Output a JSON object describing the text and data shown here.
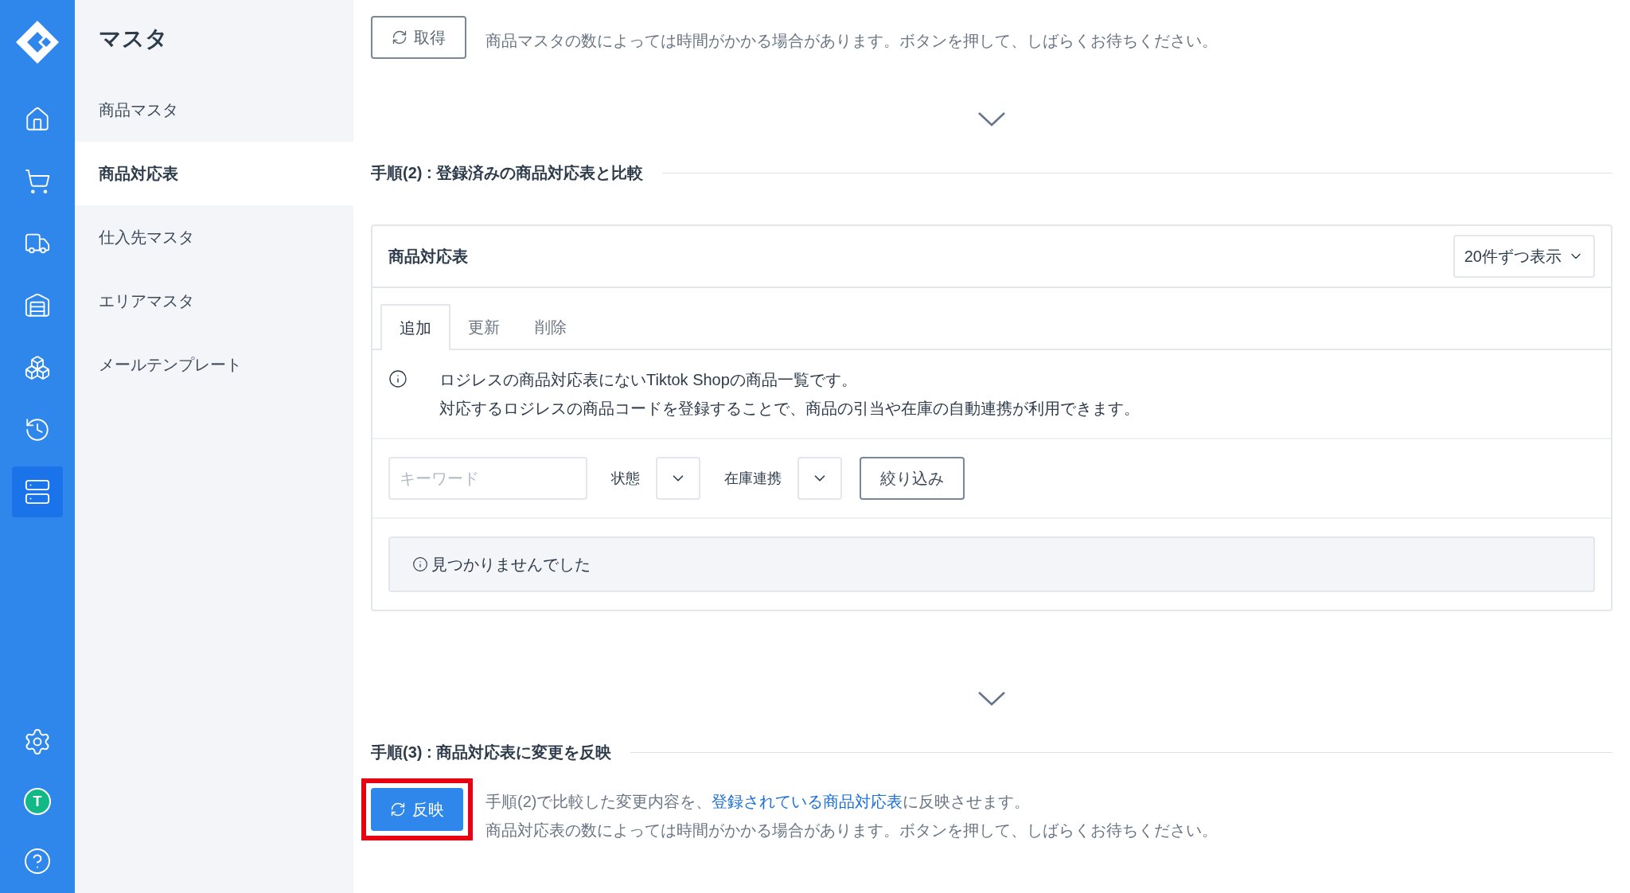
{
  "rail": {
    "items": [
      {
        "kind": "home",
        "selected": false
      },
      {
        "kind": "cart",
        "selected": false
      },
      {
        "kind": "truck",
        "selected": false
      },
      {
        "kind": "warehouse",
        "selected": false
      },
      {
        "kind": "boxes",
        "selected": false
      },
      {
        "kind": "history",
        "selected": false
      },
      {
        "kind": "master",
        "selected": true
      }
    ],
    "bottom": [
      {
        "kind": "settings"
      },
      {
        "kind": "avatar",
        "label": "T"
      },
      {
        "kind": "help"
      }
    ]
  },
  "sidebar": {
    "title": "マスタ",
    "items": [
      {
        "label": "商品マスタ",
        "selected": false
      },
      {
        "label": "商品対応表",
        "selected": true
      },
      {
        "label": "仕入先マスタ",
        "selected": false
      },
      {
        "label": "エリアマスタ",
        "selected": false
      },
      {
        "label": "メールテンプレート",
        "selected": false
      }
    ]
  },
  "step1": {
    "button": "取得",
    "note": "商品マスタの数によっては時間がかかる場合があります。ボタンを押して、しばらくお待ちください。"
  },
  "step2": {
    "heading": "手順(2) : 登録済みの商品対応表と比較",
    "card": {
      "title": "商品対応表",
      "page_size": "20件ずつ表示",
      "tabs": [
        {
          "label": "追加",
          "selected": true
        },
        {
          "label": "更新",
          "selected": false
        },
        {
          "label": "削除",
          "selected": false
        }
      ],
      "info": [
        "ロジレスの商品対応表にないTiktok Shopの商品一覧です。",
        "対応するロジレスの商品コードを登録することで、商品の引当や在庫の自動連携が利用できます。"
      ],
      "filters": {
        "keyword_placeholder": "キーワード",
        "status_label": "状態",
        "stock_label": "在庫連携",
        "submit": "絞り込み"
      },
      "empty": "見つかりませんでした"
    }
  },
  "step3": {
    "heading": "手順(3) : 商品対応表に変更を反映",
    "button": "反映",
    "highlighted": true,
    "note_before": "手順(2)で比較した変更内容を、",
    "link": "登録されている商品対応表",
    "note_after": "に反映させます。",
    "note2": "商品対応表の数によっては時間がかかる場合があります。ボタンを押して、しばらくお待ちください。"
  }
}
